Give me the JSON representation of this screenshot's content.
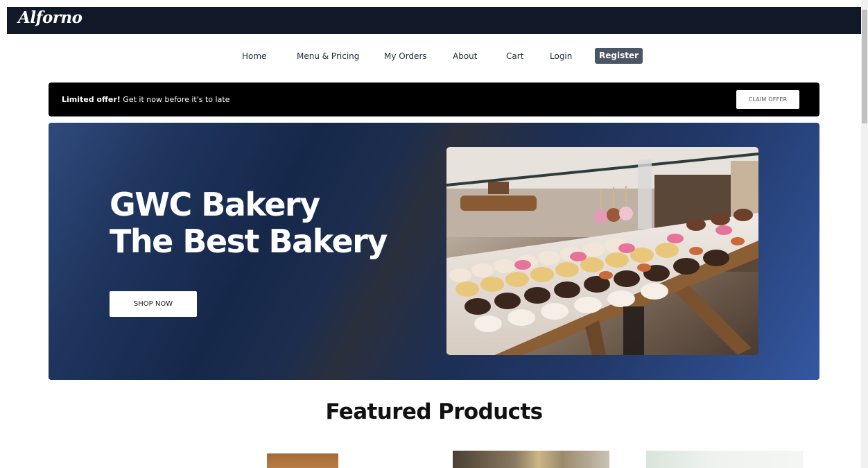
{
  "brand": {
    "name": "Alforno"
  },
  "nav": {
    "items": [
      {
        "label": "Home"
      },
      {
        "label": "Menu & Pricing"
      },
      {
        "label": "My Orders"
      },
      {
        "label": "About"
      },
      {
        "label": "Cart"
      },
      {
        "label": "Login"
      }
    ],
    "register_label": "Register"
  },
  "offer": {
    "bold": "Limited offer!",
    "text": " Get it now before it's to late",
    "button_label": "CLAIM OFFER"
  },
  "hero": {
    "title_line1": "GWC Bakery",
    "title_line2": "The Best Bakery",
    "button_label": "SHOP NOW"
  },
  "featured": {
    "title": "Featured Products"
  },
  "colors": {
    "topbar": "#111827",
    "register_bg": "#4b5563",
    "offer_bg": "#000000",
    "hero_accent": "#3457a0"
  }
}
